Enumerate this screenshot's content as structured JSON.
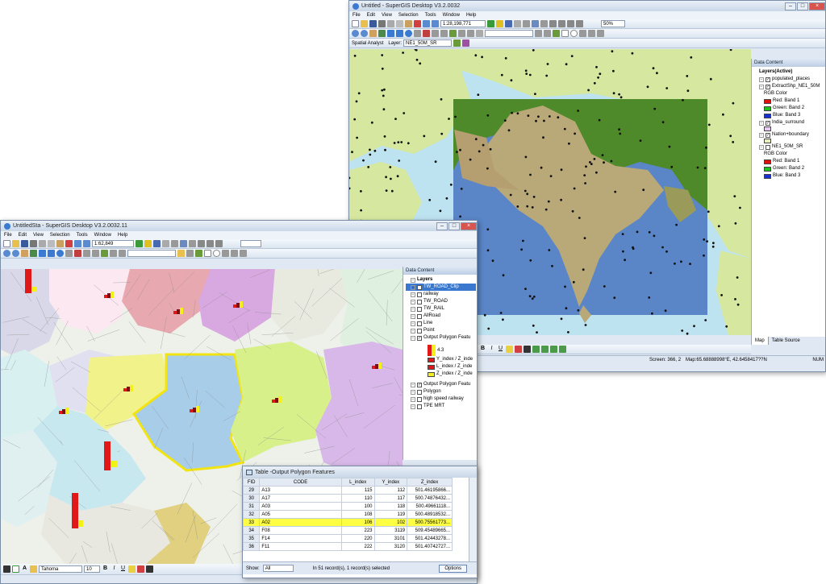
{
  "back_window": {
    "title": "Untitled - SuperGIS Desktop V3.2.0032",
    "menu": [
      "File",
      "Edit",
      "View",
      "Selection",
      "Tools",
      "Window",
      "Help"
    ],
    "scale": "1:28,198,771",
    "zoom": "50%",
    "spatial_toolbar": {
      "label": "Spatial Analyst",
      "layer_label": "Layer:",
      "layer_value": "NE1_50M_SR"
    },
    "panel_title": "Data Content",
    "layers": [
      {
        "name": "Layers(Active)",
        "level": 0,
        "checked": null,
        "bold": true
      },
      {
        "name": "populated_places",
        "level": 1,
        "checked": true
      },
      {
        "name": "ExtractShp_NE1_50M",
        "level": 1,
        "checked": true
      },
      {
        "name": "RGB Color",
        "level": 2,
        "checked": null
      },
      {
        "name": "Red:  Band 1",
        "level": 2,
        "swatch": "#e01010"
      },
      {
        "name": "Green:  Band 2",
        "level": 2,
        "swatch": "#20c020"
      },
      {
        "name": "Blue:  Band 3",
        "level": 2,
        "swatch": "#1a2fd0"
      },
      {
        "name": "India_surround",
        "level": 1,
        "checked": true
      },
      {
        "name": "",
        "level": 2,
        "swatch": "#e6c8f0"
      },
      {
        "name": "Nation+boundary",
        "level": 1,
        "checked": true
      },
      {
        "name": "",
        "level": 2,
        "swatch": "#e8f0c0"
      },
      {
        "name": "NE1_50M_SR",
        "level": 1,
        "checked": false
      },
      {
        "name": "RGB Color",
        "level": 2,
        "checked": null
      },
      {
        "name": "Red:  Band 1",
        "level": 2,
        "swatch": "#e01010"
      },
      {
        "name": "Green:  Band 2",
        "level": 2,
        "swatch": "#20c020"
      },
      {
        "name": "Blue:  Band 3",
        "level": 2,
        "swatch": "#1a2fd0"
      }
    ],
    "panel_tabs": [
      "Map",
      "Table Source"
    ],
    "status": {
      "screen": "Screen: 366, 2",
      "map": "Map:65.68888998°E, 42.6458417??N",
      "num": "NUM"
    },
    "colors": {
      "land": "#d6e8a0",
      "sea": "#c8e6f0",
      "india_land": "#b9a878",
      "raster_green": "#4f8a2a",
      "raster_sea": "#5a86c8"
    }
  },
  "front_window": {
    "title": "UntitledSta - SuperGIS Desktop V3.2.0032.11",
    "menu": [
      "File",
      "Edit",
      "View",
      "Selection",
      "Tools",
      "Window",
      "Help"
    ],
    "scale": "1:62,849",
    "panel_title": "Data Content",
    "layers": [
      {
        "name": "Layers",
        "level": 0,
        "bold": true
      },
      {
        "name": "TW_ROAD_Clip",
        "level": 1,
        "checked": true,
        "selected": true
      },
      {
        "name": "",
        "level": 1,
        "checked": null
      },
      {
        "name": "railway",
        "level": 1,
        "checked": false
      },
      {
        "name": "TW_ROAD",
        "level": 1,
        "checked": false
      },
      {
        "name": "TW_RAIL",
        "level": 1,
        "checked": false
      },
      {
        "name": "AllRoad",
        "level": 1,
        "checked": false
      },
      {
        "name": "Line",
        "level": 1,
        "checked": false
      },
      {
        "name": "Point",
        "level": 1,
        "checked": false
      },
      {
        "name": "Output Polygon Featu",
        "level": 1,
        "checked": true
      }
    ],
    "legend": {
      "value": "4.3",
      "items": [
        {
          "label": "Y_index / Z_inde",
          "color": "#e01818"
        },
        {
          "label": "L_index / Z_inde",
          "color": "#e01818"
        },
        {
          "label": "Z_index / Z_inde",
          "color": "#f2f21a"
        }
      ]
    },
    "layers_after": [
      {
        "name": "Output Polygon Featu",
        "checked": true
      },
      {
        "name": "Polygon",
        "checked": false
      },
      {
        "name": "high speed railway",
        "checked": false
      },
      {
        "name": "TPE MRT",
        "checked": false
      }
    ],
    "font_toolbar": {
      "font": "Tahoma",
      "size": "10"
    }
  },
  "table_window": {
    "title": "Table -Output Polygon Features",
    "columns": [
      "FID",
      "CODE",
      "L_index",
      "Y_index",
      "Z_index"
    ],
    "rows": [
      {
        "fid": "29",
        "code": "A13",
        "l": "115",
        "y": "112",
        "z": "501.46195866..."
      },
      {
        "fid": "30",
        "code": "A17",
        "l": "110",
        "y": "117",
        "z": "500.74876432..."
      },
      {
        "fid": "31",
        "code": "A03",
        "l": "100",
        "y": "118",
        "z": "500.49661118..."
      },
      {
        "fid": "32",
        "code": "A05",
        "l": "108",
        "y": "119",
        "z": "500.48918532..."
      },
      {
        "fid": "33",
        "code": "A02",
        "l": "106",
        "y": "102",
        "z": "500.75561773...",
        "selected": true
      },
      {
        "fid": "34",
        "code": "F08",
        "l": "223",
        "y": "3119",
        "z": "509.45489665..."
      },
      {
        "fid": "35",
        "code": "F14",
        "l": "220",
        "y": "3101",
        "z": "501.42443278..."
      },
      {
        "fid": "36",
        "code": "F11",
        "l": "222",
        "y": "3120",
        "z": "501.40742727..."
      }
    ],
    "show_label": "Show:",
    "show_value": "All",
    "record_text": "In 51 record(s), 1 record(s) selected",
    "options_label": "Options"
  }
}
